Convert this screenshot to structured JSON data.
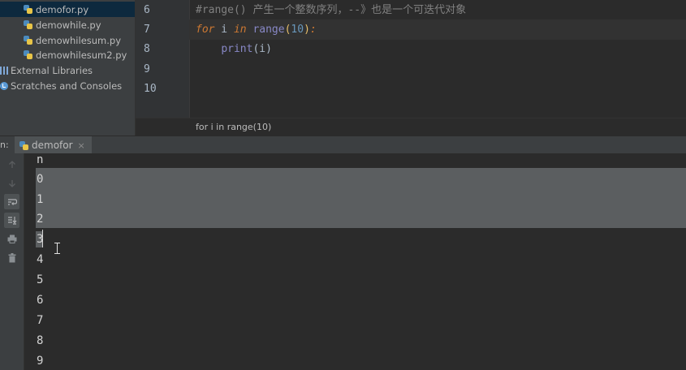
{
  "project_tree": {
    "items": [
      {
        "label": "demofor.py",
        "icon": "python-file-icon",
        "selected": true
      },
      {
        "label": "demowhile.py",
        "icon": "python-file-icon"
      },
      {
        "label": "demowhilesum.py",
        "icon": "python-file-icon"
      },
      {
        "label": "demowhilesum2.py",
        "icon": "python-file-icon"
      },
      {
        "label": "External Libraries",
        "icon": "library-icon"
      },
      {
        "label": "Scratches and Consoles",
        "icon": "scratch-icon"
      }
    ]
  },
  "editor": {
    "lines": [
      {
        "number": "6",
        "comment": "#range() 产生一个整数序列，--》也是一个可迭代对象"
      },
      {
        "number": "7",
        "kw_for": "for",
        "var_i": " i ",
        "kw_in": "in",
        "range_fn": " range",
        "open": "(",
        "arg": "10",
        "close": ")",
        "colon": ":"
      },
      {
        "number": "8",
        "indent": "    ",
        "print_fn": "print",
        "print_args": "(i)"
      },
      {
        "number": "9"
      },
      {
        "number": "10"
      }
    ],
    "breadcrumb": "for i in range(10)"
  },
  "run_panel": {
    "label": "n:",
    "tab": {
      "label": "demofor",
      "icon": "python-file-icon",
      "close": "×"
    },
    "toolbar": [
      "arrow-up-icon",
      "arrow-down-icon",
      "soft-wrap-icon",
      "scroll-to-end-icon",
      "print-icon",
      "trash-icon"
    ],
    "output": [
      "n",
      "0",
      "1",
      "2",
      "3",
      "4",
      "5",
      "6",
      "7",
      "8",
      "9"
    ]
  },
  "colors": {
    "background": "#2b2b2b",
    "panel": "#3c3f41",
    "selection": "#5b5e60",
    "keyword": "#cc7832",
    "number": "#6897bb",
    "comment": "#808080"
  }
}
